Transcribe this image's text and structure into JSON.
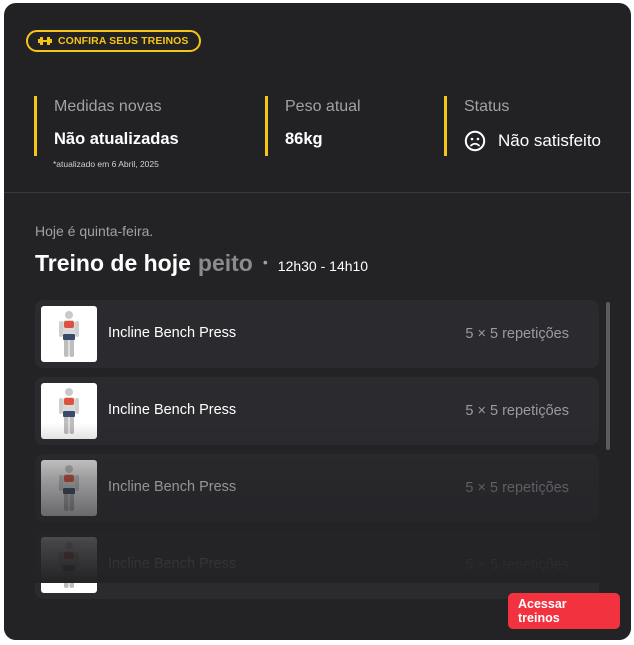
{
  "badge": {
    "label": "CONFIRA SEUS TREINOS",
    "icon": "dumbbell-icon",
    "color": "#f5c518"
  },
  "stats": [
    {
      "label": "Medidas novas",
      "value": "Não atualizadas"
    },
    {
      "label": "Peso atual",
      "value": "86kg"
    },
    {
      "label": "Status",
      "value": "Não satisfeito",
      "icon": "sad-face-icon"
    }
  ],
  "updated_note": "*atualizado em 6 Abril, 2025",
  "workout": {
    "day_text": "Hoje é quinta-feira.",
    "title": "Treino de hoje",
    "muscle": "peito",
    "separator": "•",
    "time": "12h30 - 14h10"
  },
  "exercises": [
    {
      "name": "Incline Bench Press",
      "reps": "5 × 5 repetições",
      "icon": "exercise-figure-icon"
    },
    {
      "name": "Incline Bench Press",
      "reps": "5 × 5 repetições",
      "icon": "exercise-figure-icon"
    },
    {
      "name": "Incline Bench Press",
      "reps": "5 × 5 repetições",
      "icon": "exercise-figure-icon"
    },
    {
      "name": "Incline Bench Press",
      "reps": "5 × 5 repetições",
      "icon": "exercise-figure-icon"
    }
  ],
  "cta": {
    "label": "Acessar treinos",
    "color": "#f2333f"
  },
  "colors": {
    "accent": "#f5c518",
    "background": "#222225",
    "muted_text": "#a1a1a6"
  }
}
